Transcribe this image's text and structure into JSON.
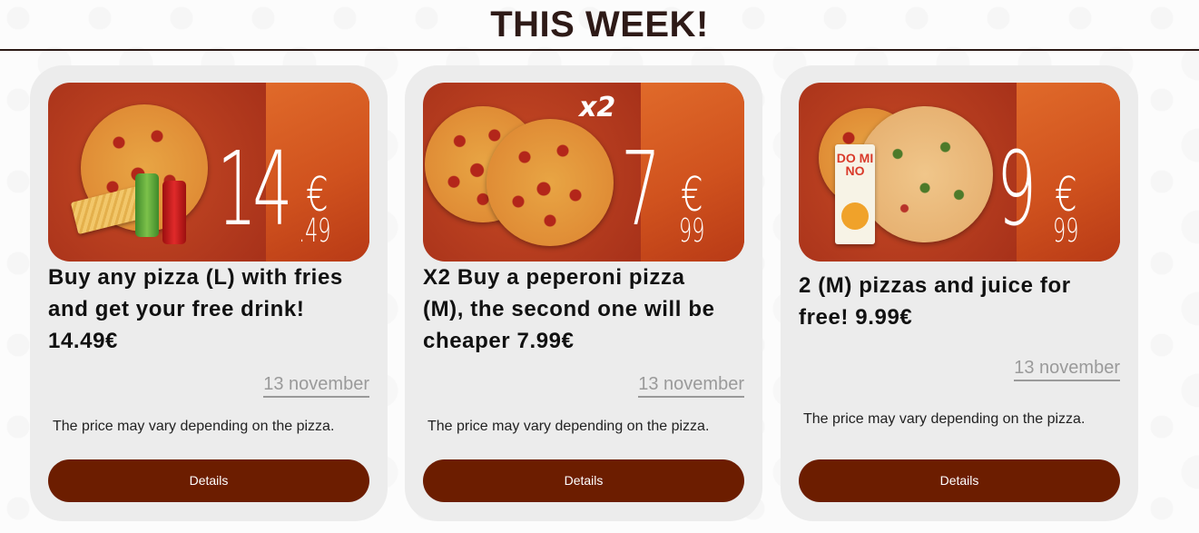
{
  "section_title": "THIS WEEK!",
  "colors": {
    "button": "#6c1d00",
    "card_bg": "#ececec",
    "title": "#2e1a17"
  },
  "offers": [
    {
      "title": "Buy any pizza (L) with fries and get your free drink! 14.49€",
      "date": "13 november",
      "note": "The price may vary depending on the pizza.",
      "button": "Details",
      "price_main": "14",
      "price_currency": "€",
      "price_cents": ".49"
    },
    {
      "title": "X2 Buy a peperoni pizza (M), the second one will be cheaper 7.99€",
      "date": "13 november",
      "note": "The price may vary depending on the pizza.",
      "button": "Details",
      "badge": "x2",
      "price_main": "7",
      "price_currency": "€",
      "price_cents": "99"
    },
    {
      "title": "2 (M) pizzas and juice for free! 9.99€",
      "date": "13 november",
      "note": "The price may vary depending on the pizza.",
      "button": "Details",
      "price_main": "9",
      "price_currency": "€",
      "price_cents": "99",
      "juice_label": "DO MI NO"
    }
  ]
}
